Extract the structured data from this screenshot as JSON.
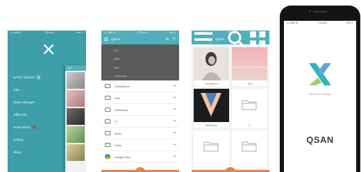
{
  "colors": {
    "teal": "#3e9fab",
    "teal_bar": "#4fb0bb",
    "accent_orange": "#f07f4a",
    "logo_teal": "#2fb3c0",
    "logo_blue": "#5aa6d6",
    "logo_green": "#9fcc6a",
    "menu_dark": "#5a5a5a"
  },
  "status_bar": {
    "carrier": "••••• 中华 令",
    "time": "下午12:29",
    "battery": "55% ▭"
  },
  "menu_screen": {
    "logo_icon": "qsan-x-logo",
    "items": [
      {
        "label": "NAS01 (admin)",
        "icon": "ring"
      },
      {
        "label": "Tabs",
        "icon": ""
      },
      {
        "label": "Share Manager",
        "icon": ""
      },
      {
        "label": "Offline file",
        "icon": ""
      },
      {
        "label": "Notifications",
        "icon": "red-dot"
      },
      {
        "label": "Setting",
        "icon": ""
      },
      {
        "label": "About",
        "icon": ""
      }
    ],
    "peek_title": "QFile"
  },
  "list_screen": {
    "title": "QSAN",
    "dropdown": [
      "A-Z",
      "Date",
      "Size",
      "Customize"
    ],
    "files": [
      {
        "name": "Surveillance",
        "icon": "folder-icon"
      },
      {
        "name": "Test",
        "icon": "folder-icon"
      },
      {
        "name": "NetBackup",
        "icon": "folder-icon"
      },
      {
        "name": "IT",
        "icon": "folder-icon"
      },
      {
        "name": "Music",
        "icon": "folder-icon"
      },
      {
        "name": "Video",
        "icon": "folder-icon"
      },
      {
        "name": "Google Drive",
        "icon": "google-drive-icon"
      }
    ],
    "more_glyph": "•••"
  },
  "grid_screen": {
    "title": "QSAN",
    "cells": [
      {
        "caption": "Surveillance",
        "kind": "photo-woman"
      },
      {
        "caption": "Test",
        "kind": "photo-pink"
      },
      {
        "caption": "NetBackup",
        "kind": "photo-v"
      },
      {
        "caption": "IT",
        "kind": "folder"
      },
      {
        "caption": "",
        "kind": "folder"
      },
      {
        "caption": "",
        "kind": "folder"
      }
    ]
  },
  "phone": {
    "slogan": "Access file manager",
    "brand": "QSAN",
    "logo_icon": "qsan-x-logo"
  }
}
